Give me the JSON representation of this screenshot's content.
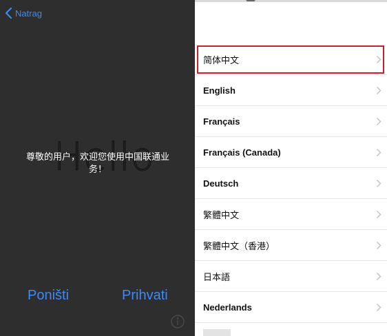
{
  "nav": {
    "back_label": "Natrag"
  },
  "alert": {
    "background_word": "Hello",
    "message": "尊敬的用户，欢迎您使用中国联通业务！",
    "cancel_label": "Poništi",
    "accept_label": "Prihvati"
  },
  "languages": {
    "items": [
      {
        "label": "简体中文",
        "selected": true
      },
      {
        "label": "English"
      },
      {
        "label": "Français"
      },
      {
        "label": "Français (Canada)"
      },
      {
        "label": "Deutsch"
      },
      {
        "label": "繁體中文"
      },
      {
        "label": "繁體中文（香港）"
      },
      {
        "label": "日本語"
      },
      {
        "label": "Nederlands"
      }
    ]
  },
  "colors": {
    "accent": "#3d8af5",
    "highlight_border": "#c8202a",
    "dark_panel": "#2e2e2e"
  }
}
